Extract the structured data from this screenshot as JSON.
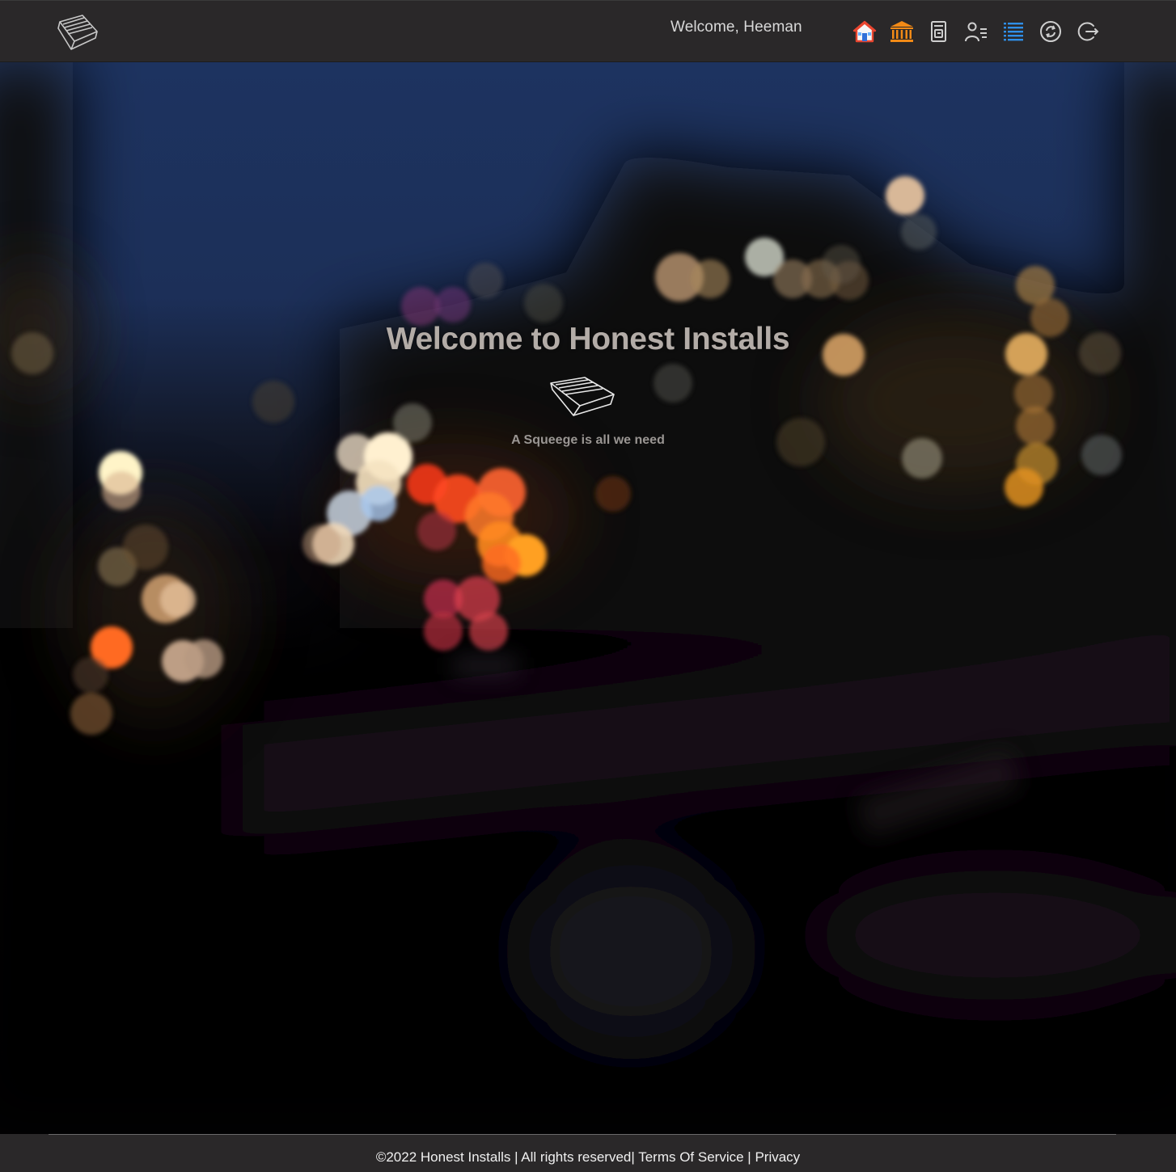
{
  "header": {
    "welcome_text": "Welcome, Heeman",
    "nav_icons": [
      {
        "name": "home-icon",
        "color": "#e8452f"
      },
      {
        "name": "bank-icon",
        "color": "#f28a16"
      },
      {
        "name": "document-icon",
        "color": "#cfcfcf"
      },
      {
        "name": "user-list-icon",
        "color": "#cfcfcf"
      },
      {
        "name": "list-icon",
        "color": "#2f8fe8"
      },
      {
        "name": "sync-icon",
        "color": "#cfcfcf"
      },
      {
        "name": "logout-icon",
        "color": "#cfcfcf"
      }
    ]
  },
  "hero": {
    "title": "Welcome to Honest Installs",
    "tagline": "A Squeege is all we need",
    "logo_icon": "squeegee-icon"
  },
  "footer": {
    "copyright": "©2022 Honest Installs | All rights reserved",
    "separator_1": "| ",
    "terms": "Terms Of Service",
    "separator_2": " | ",
    "privacy": "Privacy"
  },
  "colors": {
    "bar_background": "#2a2829",
    "sky": "#1e3462",
    "title_text": "#b3aca7",
    "tagline_text": "#9a9693"
  }
}
